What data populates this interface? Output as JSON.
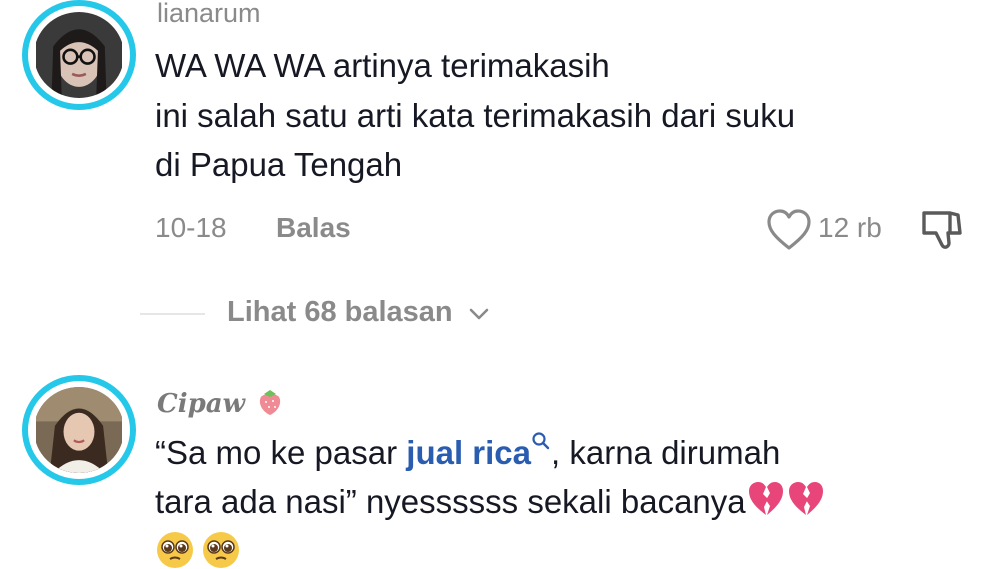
{
  "comments": [
    {
      "username": "lianarum",
      "lines": [
        "WA WA WA artinya terimakasih",
        "ini salah satu arti kata terimakasih dari suku",
        "di Papua Tengah"
      ],
      "date": "10-18",
      "reply_label": "Balas",
      "like_count": "12 rb",
      "view_replies": "Lihat 68 balasan"
    },
    {
      "username": "Cipaw",
      "text_before_link": "“Sa mo ke pasar ",
      "link_text": "jual rica",
      "text_after_link": ", karna dirumah",
      "line2": "tara ada nasi” nyessssss sekali bacanya"
    }
  ],
  "colors": {
    "avatar_ring": "#25c8e8",
    "link": "#2a5db0",
    "muted": "#8a8a8a",
    "text": "#161823",
    "broken_heart": "#e8457a"
  },
  "icons": {
    "like": "heart-outline-icon",
    "dislike": "thumbs-down-icon",
    "chevron": "chevron-down-icon",
    "search": "search-icon",
    "strawberry": "strawberry-emoji",
    "broken_heart": "broken-heart-emoji",
    "pleading_face": "pleading-face-emoji"
  }
}
